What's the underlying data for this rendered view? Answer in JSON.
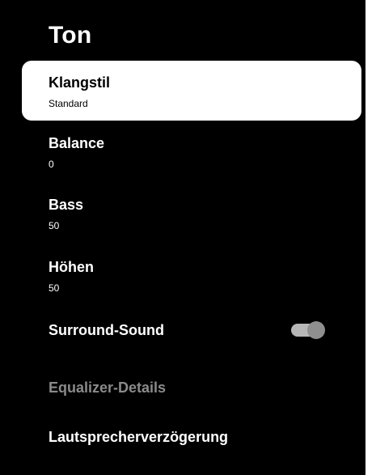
{
  "menu": {
    "title": "Ton",
    "items": [
      {
        "label": "Klangstil",
        "value": "Standard"
      },
      {
        "label": "Balance",
        "value": "0"
      },
      {
        "label": "Bass",
        "value": "50"
      },
      {
        "label": "Höhen",
        "value": "50"
      },
      {
        "label": "Surround-Sound",
        "toggle_on": true
      },
      {
        "label": "Equalizer-Details",
        "disabled": true
      },
      {
        "label": "Lautsprecherverzögerung"
      }
    ]
  },
  "colors": {
    "background": "#000000",
    "text": "#ffffff",
    "selected_bg": "#ffffff",
    "disabled_text": "#8a8a8a",
    "toggle_track": "#b7b7b7",
    "toggle_knob": "#8f8f8f"
  }
}
